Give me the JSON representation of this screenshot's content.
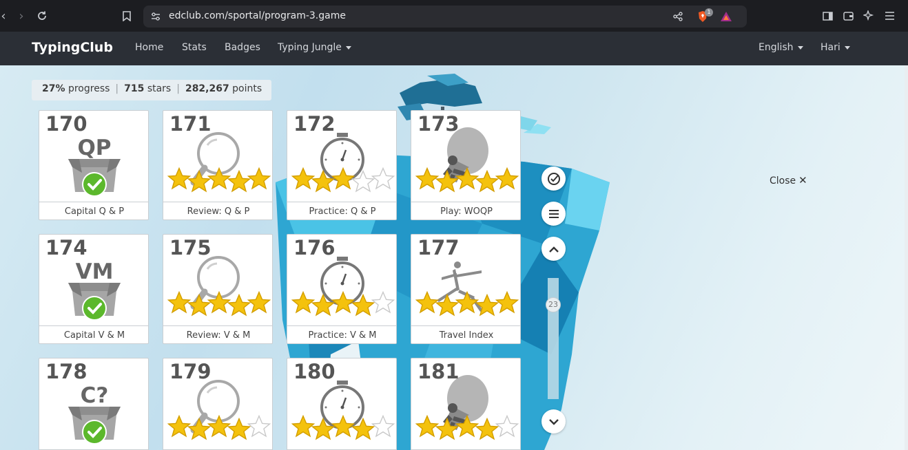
{
  "browser": {
    "url": "edclub.com/sportal/program-3.game",
    "badge_count": "1"
  },
  "header": {
    "logo": "TypingClub",
    "nav": [
      "Home",
      "Stats",
      "Badges",
      "Typing Jungle"
    ],
    "language": "English",
    "user": "Hari"
  },
  "stats": {
    "progress": "27%",
    "progress_label": "progress",
    "stars": "715",
    "stars_label": "stars",
    "points": "282,267",
    "points_label": "points"
  },
  "lessons": [
    {
      "num": "170",
      "label": "Capital Q & P",
      "type": "capital",
      "letters": "QP",
      "done": true
    },
    {
      "num": "171",
      "label": "Review: Q & P",
      "type": "review",
      "stars": 5
    },
    {
      "num": "172",
      "label": "Practice: Q & P",
      "type": "practice",
      "stars": 3
    },
    {
      "num": "173",
      "label": "Play: WOQP",
      "type": "play",
      "stars": 5
    },
    {
      "num": "174",
      "label": "Capital V & M",
      "type": "capital",
      "letters": "VM",
      "done": true
    },
    {
      "num": "175",
      "label": "Review: V & M",
      "type": "review",
      "stars": 5
    },
    {
      "num": "176",
      "label": "Practice: V & M",
      "type": "practice",
      "stars": 4
    },
    {
      "num": "177",
      "label": "Travel Index",
      "type": "yoga",
      "stars": 5
    },
    {
      "num": "178",
      "label": "",
      "type": "capital",
      "letters": "C?",
      "done": true
    },
    {
      "num": "179",
      "label": "",
      "type": "review",
      "stars": 4
    },
    {
      "num": "180",
      "label": "",
      "type": "practice",
      "stars": 4
    },
    {
      "num": "181",
      "label": "",
      "type": "play",
      "stars": 4
    }
  ],
  "side_controls": {
    "slider_value": "23"
  },
  "close_label": "Close",
  "colors": {
    "header_bg": "#2b2f36",
    "star": "#f4c20d",
    "check": "#5cb82c",
    "scene_bg": "#c9e4ef"
  }
}
